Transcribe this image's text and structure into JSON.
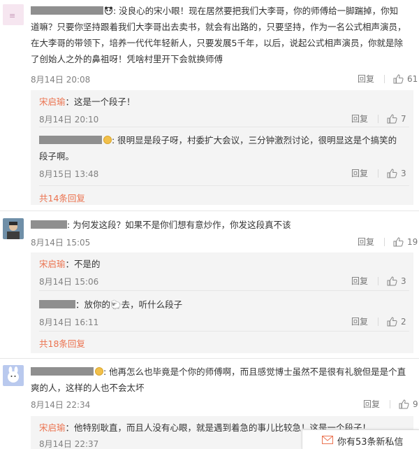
{
  "comments": [
    {
      "text": ": 没良心的宋小眼！现在居然要把我们大李哥，你的师傅给一脚踹掉，你知道嘛？只要你坚持跟着我们大李哥出去卖书，就会有出路的，只要坚持，作为一名公式相声演员，在大李哥的带领下，培养一代代年轻新人，只要发展5千年，以后，说起公式相声演员，你就是除了创始人之外的鼻祖呀！凭啥村里开下会就换师傅",
      "text_lines": [
        ": 没良心的宋小眼！现在居然要把我们大李哥，你的师傅给一脚踹掉，你知",
        "道嘛？只要你坚持跟着我们大李哥出去卖书，就会有出路的，只要坚持，作为一名公式相声演员，",
        "在大李哥的带领下，培养一代代年轻新人，只要发展5千年，以后，说起公式相声演员，你就是除",
        "了创始人之外的鼻祖呀！凭啥村里开下会就换师傅"
      ],
      "time": "8月14日 20:08",
      "reply_label": "回复",
      "likes": "61",
      "replies": [
        {
          "author": "宋启瑜",
          "text": "：这是一个段子！",
          "time": "8月14日 20:10",
          "reply_label": "回复",
          "likes": "7"
        },
        {
          "text_lines": [
            ": 很明显是段子呀，村委扩大会议，三分钟激烈讨论，很明显这是个搞笑的",
            "段子啊。"
          ],
          "time": "8月15日 13:48",
          "reply_label": "回复",
          "likes": "3"
        }
      ],
      "more": "共14条回复"
    },
    {
      "text": ": 为何发这段？如果不是你们想有意炒作，你发这段真不该",
      "time": "8月14日 15:05",
      "reply_label": "回复",
      "likes": "19",
      "replies": [
        {
          "author": "宋启瑜",
          "text": "：不是的",
          "time": "8月14日 15:06",
          "reply_label": "回复",
          "likes": "3"
        },
        {
          "text": "：放你的🐑去，听什么段子",
          "time": "8月14日 16:11",
          "reply_label": "回复",
          "likes": "2"
        }
      ],
      "more": "共18条回复"
    },
    {
      "text_lines": [
        ": 他再怎么也毕竟是个你的师傅啊，而且感觉博士虽然不是很有礼貌但是是个直",
        "爽的人，这样的人也不会太坏"
      ],
      "time": "8月14日 22:34",
      "reply_label": "回复",
      "likes": "9",
      "replies": [
        {
          "author": "宋启瑜",
          "text": "：他特别耿直，而且人没有心眼，就是遇到着急的事儿比较急！这是一个段子！",
          "time": "8月14日 22:37"
        }
      ]
    }
  ],
  "notification": {
    "text": "你有53条新私信"
  },
  "colors": {
    "author": "#eb7350",
    "redaction": "#8f8f8f",
    "reply_bg": "#f4f4f4"
  },
  "icons": {
    "like": "thumbs-up-icon",
    "badge": "gold-badge-icon",
    "mail": "envelope-icon"
  }
}
